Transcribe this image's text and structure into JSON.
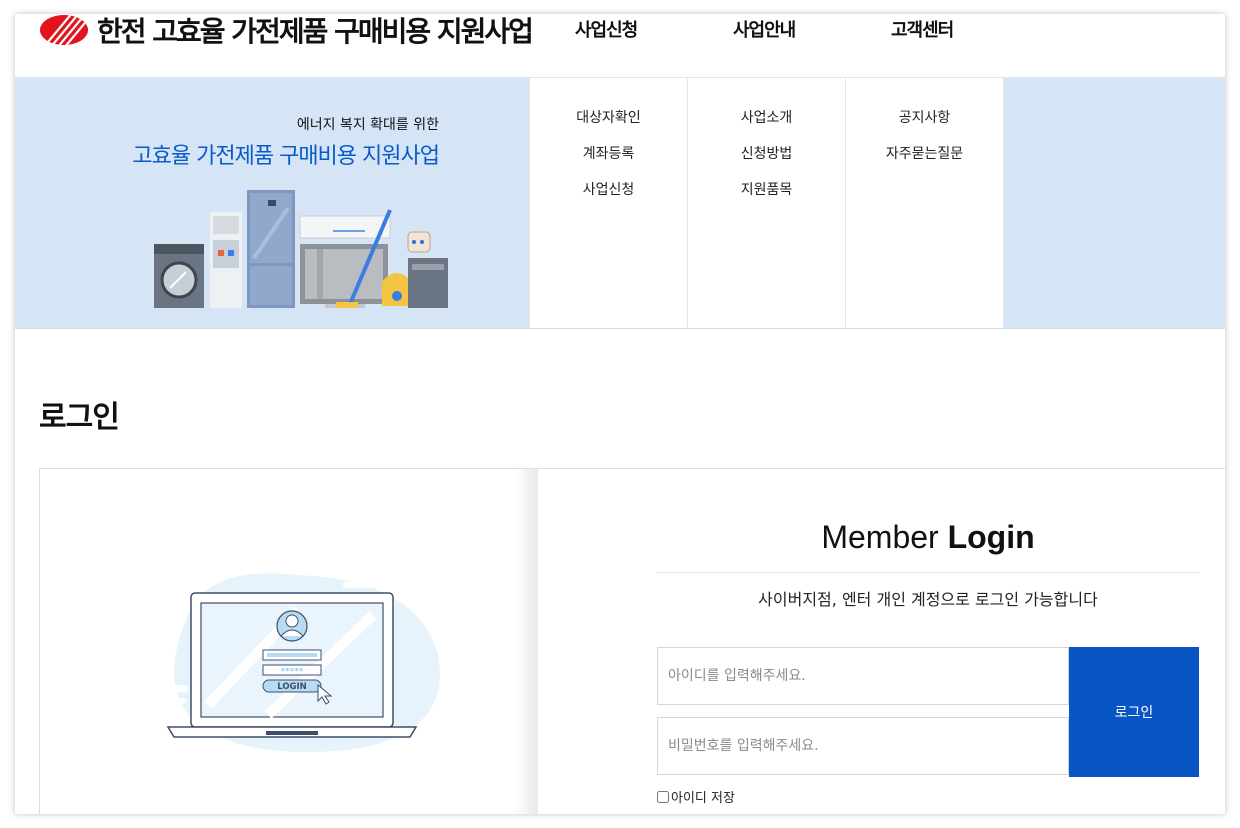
{
  "header": {
    "logo_text": "한전 고효율 가전제품 구매비용 지원사업",
    "nav": [
      "사업신청",
      "사업안내",
      "고객센터"
    ]
  },
  "mega_menu": {
    "promo_subtitle": "에너지 복지 확대를 위한",
    "promo_title": "고효율 가전제품 구매비용 지원사업",
    "columns": [
      {
        "items": [
          "대상자확인",
          "계좌등록",
          "사업신청"
        ]
      },
      {
        "items": [
          "사업소개",
          "신청방법",
          "지원품목"
        ]
      },
      {
        "items": [
          "공지사항",
          "자주묻는질문"
        ]
      }
    ]
  },
  "page": {
    "title": "로그인"
  },
  "login": {
    "title_light": "Member ",
    "title_bold": "Login",
    "notice": "사이버지점, 엔터 개인 계정으로 로그인 가능합니다",
    "id_placeholder": "아이디를 입력해주세요.",
    "pw_placeholder": "비밀번호를 입력해주세요.",
    "button_label": "로그인",
    "remember_label": "아이디 저장",
    "illustration_button": "LOGIN",
    "illustration_password": "*****"
  },
  "colors": {
    "brand_blue": "#0a55c5",
    "menu_bg": "#d6e5f6",
    "logo_red": "#e1141e"
  },
  "icons": [
    "kepco-logo-icon",
    "appliances-illustration",
    "laptop-login-illustration",
    "user-avatar-icon",
    "cursor-icon"
  ]
}
